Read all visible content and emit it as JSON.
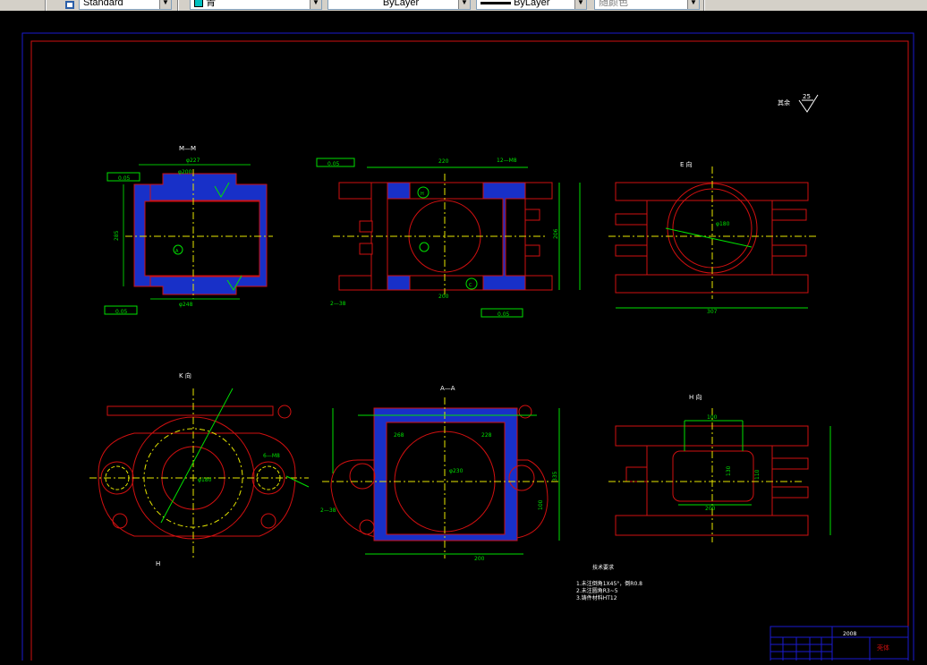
{
  "toolbar": {
    "textstyle": "Standard",
    "layer": "青",
    "linetype": "ByLayer",
    "lineweight": "ByLayer",
    "plotstyle": "随颜色"
  },
  "drawing": {
    "section_mm": "M—M",
    "section_aa": "A—A",
    "section_h": "H 向",
    "section_k": "K 向",
    "view_label": "E 向",
    "roughness_note": "其余",
    "roughness_value": "25",
    "tech_req_title": "技术要求",
    "tech_req_lines": [
      "1.未注倒角1X45°，倒R0.8",
      "2.未注圆角R3~5",
      "3.铸件材料HT12"
    ],
    "title_block_code": "2008",
    "title_block_name": "壳体",
    "title_block_bottom": "B1",
    "dims": {
      "tol1": "0.05",
      "tol2": "0.05",
      "tol3": "0.05",
      "tol4": "0.05",
      "d_285": "285",
      "d_220": "220",
      "d_200": "200",
      "d_307": "307",
      "d_335": "335",
      "d_268": "268",
      "d_228": "228",
      "d_100": "100",
      "d_12m8": "12—M8",
      "d_6m8": "6—M8",
      "d_2r38": "2—38",
      "d_130": "130",
      "d_110": "110",
      "d_phi180": "φ180",
      "d_phi230": "φ230",
      "d_phi488": "φ48",
      "d_phi260": "φ260"
    }
  }
}
